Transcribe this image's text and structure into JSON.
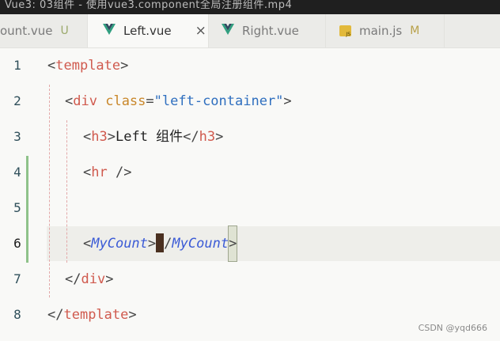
{
  "window": {
    "title_fragment": "Vue3: 03组件 - 使用vue3.component全局注册组件.mp4"
  },
  "tabs": [
    {
      "label": "ount.vue",
      "badge": "U",
      "icon": "vue-icon",
      "active": false
    },
    {
      "label": "Left.vue",
      "close": "×",
      "icon": "vue-icon",
      "active": true
    },
    {
      "label": "Right.vue",
      "icon": "vue-icon",
      "active": false
    },
    {
      "label": "main.js",
      "badge": "M",
      "icon": "js-icon",
      "active": false
    }
  ],
  "colors": {
    "tag": "#d05a4e",
    "attribute": "#c9872a",
    "string": "#2f6fbf",
    "component": "#3b5bd6",
    "git_added": "#8fc28a",
    "vue_green": "#2f9f7f"
  },
  "editor": {
    "active_line": 6,
    "lines": [
      {
        "num": "1",
        "open": "<",
        "tag": "template",
        "close": ">"
      },
      {
        "num": "2",
        "open": "<",
        "tag": "div",
        "attr": "class",
        "eq": "=",
        "value": "\"left-container\"",
        "close": ">"
      },
      {
        "num": "3",
        "open": "<",
        "tag": "h3",
        "close": ">",
        "text": "Left 组件",
        "open2": "</",
        "tag2": "h3",
        "close2": ">"
      },
      {
        "num": "4",
        "open": "<",
        "tag": "hr",
        "close": " />"
      },
      {
        "num": "5"
      },
      {
        "num": "6",
        "open": "<",
        "component": "MyCount",
        "close": ">",
        "open2": "/",
        "component2": "MyCount",
        "close2": ">"
      },
      {
        "num": "7",
        "open": "</",
        "tag": "div",
        "close": ">"
      },
      {
        "num": "8",
        "open": "</",
        "tag": "template",
        "close": ">"
      }
    ]
  },
  "watermark": "CSDN @yqd666"
}
